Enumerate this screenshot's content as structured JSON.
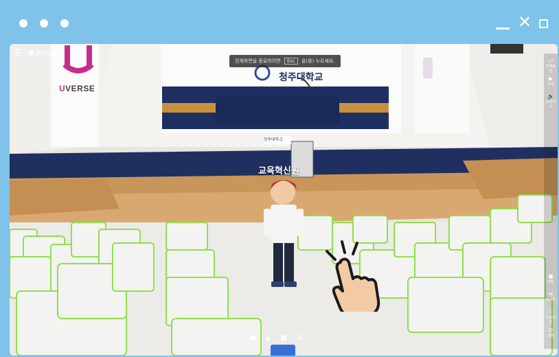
{
  "window": {
    "controls": {
      "minimize_icon": "minimize-icon",
      "close_icon": "close-icon",
      "maximize_icon": "maximize-icon"
    }
  },
  "hud": {
    "menu_icon": "☰",
    "location_label": "충주캠퍼스"
  },
  "notice": {
    "prefix": "전체화면을 종료하려면",
    "key": "Esc",
    "suffix": "을(를) 누르세요."
  },
  "scene": {
    "brand_left": "U",
    "brand_right": "VERSE",
    "banner_text": "청주대학교",
    "podium_text": "청주대학교",
    "avatar_name": "교육혁신원"
  },
  "right_rail": {
    "items": [
      {
        "icon": "⤢",
        "label": "전체화면"
      },
      {
        "icon": "▶",
        "label": "녹화"
      },
      {
        "icon": "🔊",
        "label": "소리켜기"
      },
      {
        "icon": "●",
        "label": "채팅"
      },
      {
        "icon": "✉",
        "label": "메세지"
      },
      {
        "icon": "♡",
        "label": "이모티콘"
      },
      {
        "icon": "◎",
        "label": "설정"
      }
    ]
  },
  "bottom_bar": {
    "items": [
      "●",
      "▲",
      "■",
      "⊞"
    ]
  },
  "colors": {
    "frame": "#7fc3ea",
    "stage_wood": "#d8a26a",
    "navy": "#1e2f62",
    "seat_outline": "#8fe04a",
    "brand_accent": "#c62d8a"
  }
}
